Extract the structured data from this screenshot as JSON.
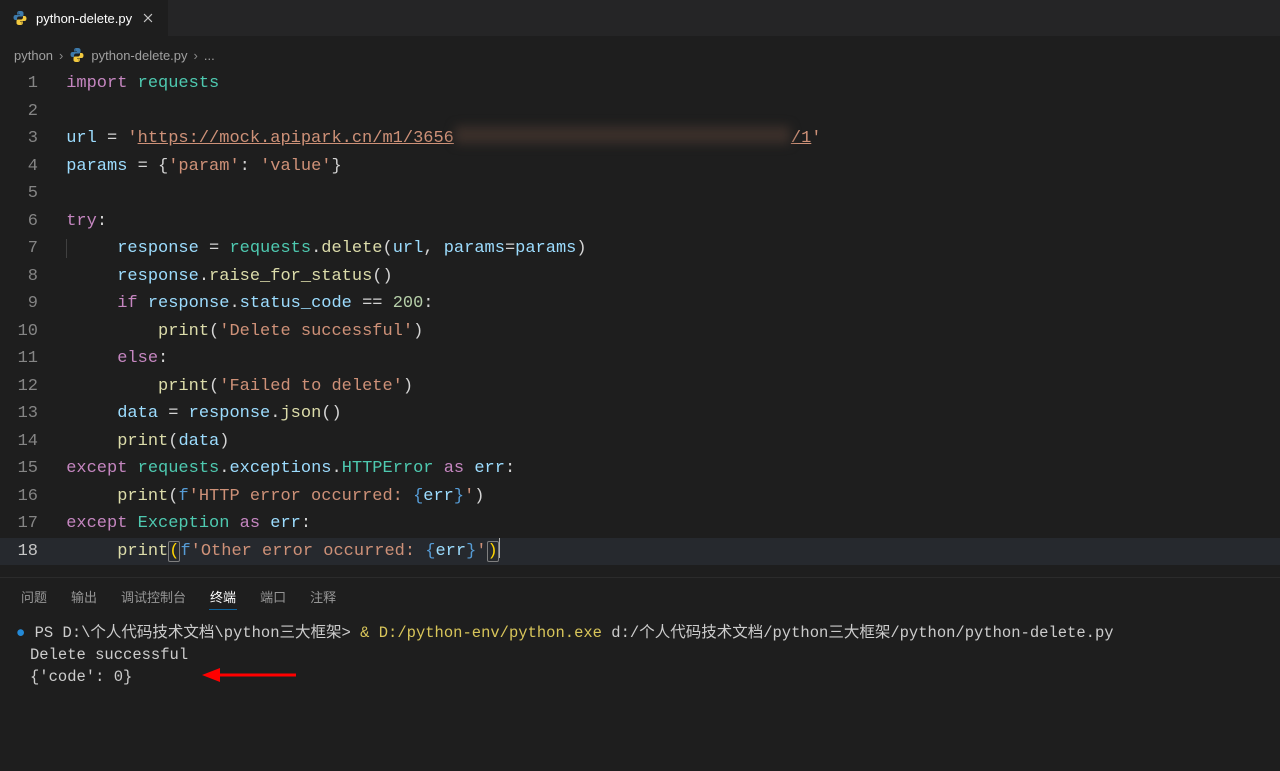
{
  "tab": {
    "filename": "python-delete.py"
  },
  "breadcrumb": {
    "folder": "python",
    "file": "python-delete.py",
    "trailing": "..."
  },
  "code": {
    "l1": {
      "import": "import",
      "mod": "requests"
    },
    "l3": {
      "url_var": "url",
      "eq": "=",
      "q": "'",
      "url_vis_pre": "https://mock.apipark.cn/m1/3656",
      "url_vis_post": "/1"
    },
    "l4": {
      "params": "params",
      "eq": "=",
      "key": "'param'",
      "val": "'value'"
    },
    "l6": {
      "try": "try",
      "colon": ":"
    },
    "l7": {
      "response": "response",
      "eq": "=",
      "requests": "requests",
      "dot": ".",
      "delete": "delete",
      "url": "url",
      "paramskw": "params",
      "params": "params"
    },
    "l8": {
      "response": "response",
      "raise": "raise_for_status"
    },
    "l9": {
      "if": "if",
      "response": "response",
      "status": "status_code",
      "eqeq": "==",
      "n200": "200",
      "colon": ":"
    },
    "l10": {
      "print": "print",
      "s": "'Delete successful'"
    },
    "l11": {
      "else": "else",
      "colon": ":"
    },
    "l12": {
      "print": "print",
      "s": "'Failed to delete'"
    },
    "l13": {
      "data": "data",
      "eq": "=",
      "response": "response",
      "json": "json"
    },
    "l14": {
      "print": "print",
      "data": "data"
    },
    "l15": {
      "except": "except",
      "requests": "requests",
      "exceptions": "exceptions",
      "err_cls": "HTTPError",
      "as": "as",
      "err": "err",
      "colon": ":"
    },
    "l16": {
      "print": "print",
      "f": "f",
      "sA": "'HTTP error occurred: ",
      "lb": "{",
      "err": "err",
      "rb": "}",
      "sB": "'"
    },
    "l17": {
      "except": "except",
      "exc": "Exception",
      "as": "as",
      "err": "err",
      "colon": ":"
    },
    "l18": {
      "print": "print",
      "f": "f",
      "sA": "'Other error occurred: ",
      "lb": "{",
      "err": "err",
      "rb": "}",
      "sB": "'"
    }
  },
  "panel": {
    "tabs": {
      "problems": "问题",
      "output": "输出",
      "debug": "调试控制台",
      "terminal": "终端",
      "ports": "端口",
      "comments": "注释"
    }
  },
  "terminal": {
    "prompt": "PS D:\\个人代码技术文档\\python三大框架> ",
    "amp": "& ",
    "exe": "D:/python-env/python.exe",
    "script": " d:/个人代码技术文档/python三大框架/python/python-delete.py",
    "out1": "Delete successful",
    "out2": "{'code': 0}"
  }
}
